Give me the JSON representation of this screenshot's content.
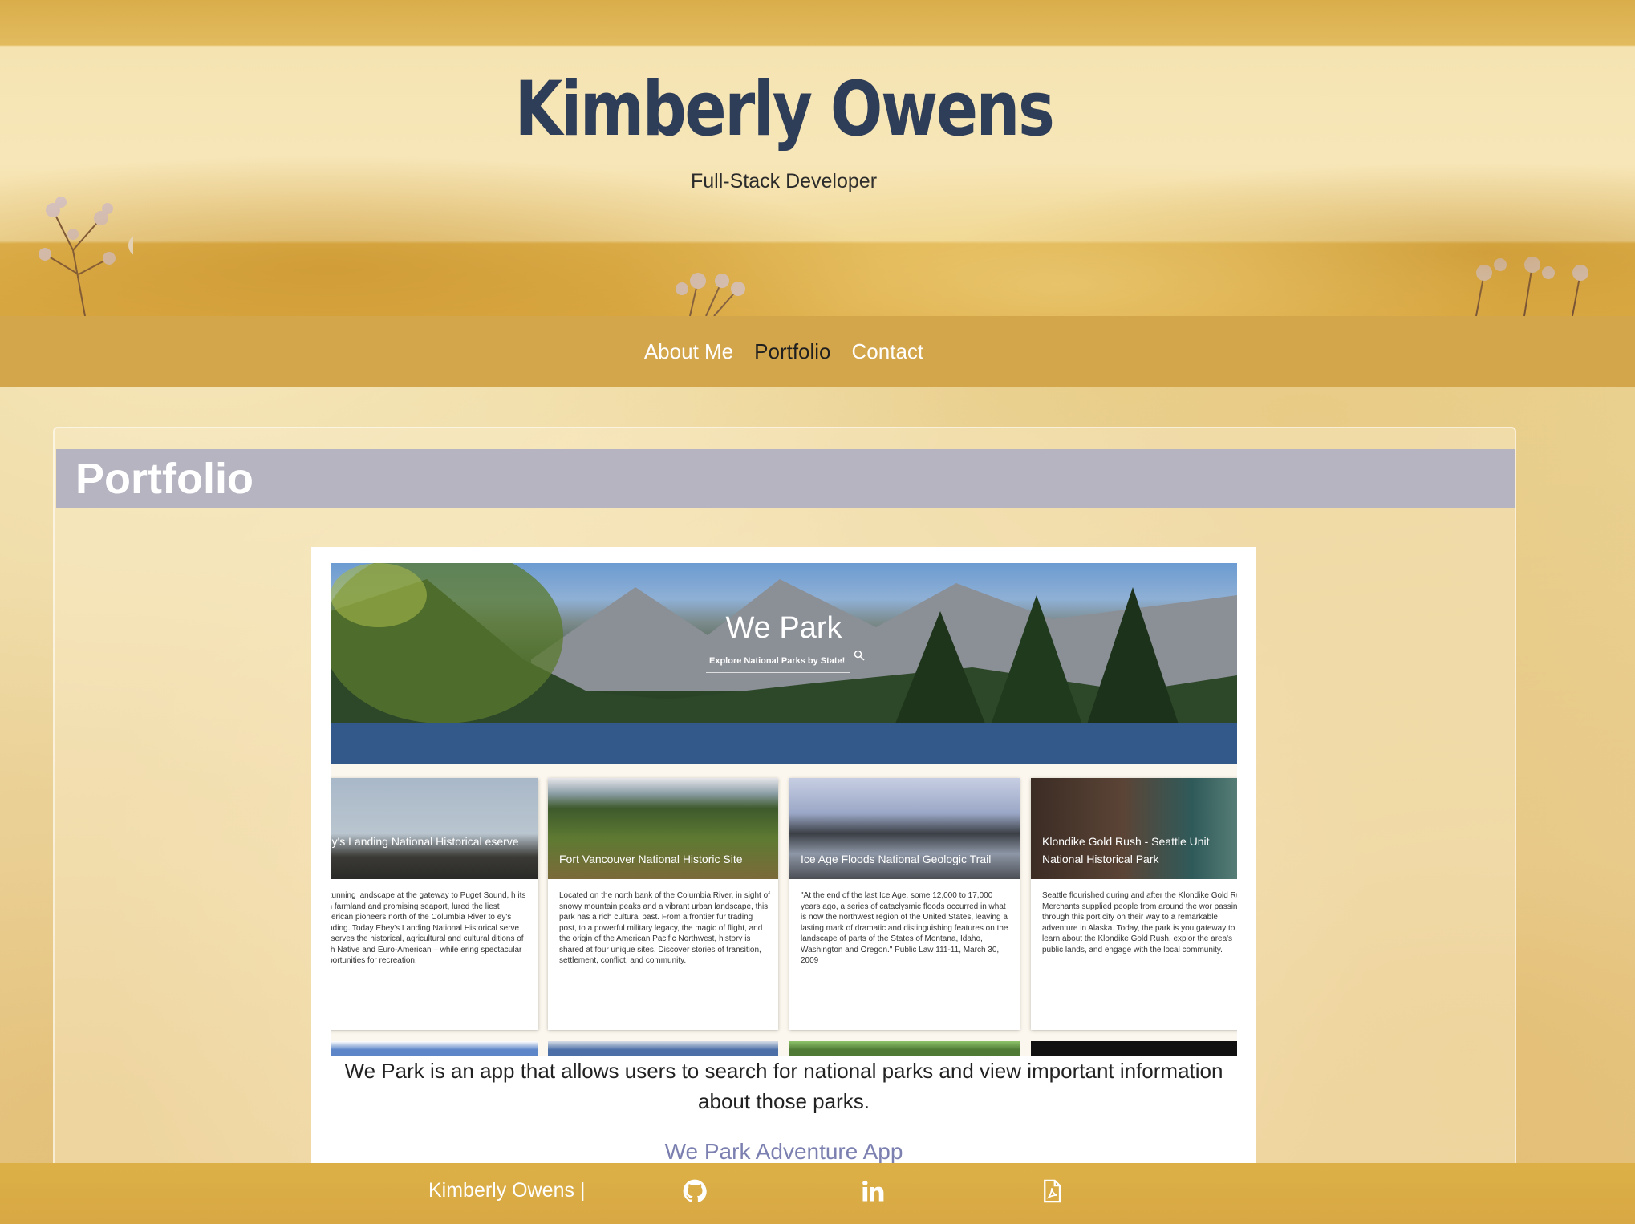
{
  "header": {
    "name": "Kimberly Owens",
    "subtitle": "Full-Stack Developer"
  },
  "nav": {
    "items": [
      {
        "label": "About Me",
        "active": false
      },
      {
        "label": "Portfolio",
        "active": true
      },
      {
        "label": "Contact",
        "active": false
      }
    ]
  },
  "portfolio": {
    "section_title": "Portfolio",
    "project": {
      "screenshot": {
        "hero_title": "We Park",
        "hero_subtitle": "Explore National Parks by State!",
        "parks": [
          {
            "name": "bey's Landing National Historical eserve",
            "description": "s stunning landscape at the gateway to Puget Sound, h its rich farmland and promising seaport, lured the liest American pioneers north of the Columbia River to ey's Landing. Today Ebey's Landing National Historical serve preserves the historical, agricultural and cultural ditions of both Native and Euro-American – while ering spectacular opportunities for recreation."
          },
          {
            "name": "Fort Vancouver National Historic Site",
            "description": "Located on the north bank of the Columbia River, in sight of snowy mountain peaks and a vibrant urban landscape, this park has a rich cultural past. From a frontier fur trading post, to a powerful military legacy, the magic of flight, and the origin of the American Pacific Northwest, history is shared at four unique sites. Discover stories of transition, settlement, conflict, and community."
          },
          {
            "name": "Ice Age Floods National Geologic Trail",
            "description": "\"At the end of the last Ice Age, some 12,000 to 17,000 years ago, a series of cataclysmic floods occurred in what is now the northwest region of the United States, leaving a lasting mark of dramatic and distinguishing features on the landscape of parts of the States of Montana, Idaho, Washington and Oregon.\" Public Law 111-11, March 30, 2009"
          },
          {
            "name": "Klondike Gold Rush - Seattle Unit National Historical Park",
            "description": "Seattle flourished during and after the Klondike Gold Rush. Merchants supplied people from around the wor passing through this port city on their way to a remarkable adventure in Alaska. Today, the park is you gateway to learn about the Klondike Gold Rush, explor the area's public lands, and engage with the local community."
          }
        ]
      },
      "description": "We Park is an app that allows users to search for national parks and view important information about those parks.",
      "link_label": "We Park Adventure App"
    }
  },
  "footer": {
    "name": "Kimberly Owens |",
    "icons": [
      "github-icon",
      "linkedin-icon",
      "pdf-resume-icon"
    ]
  },
  "colors": {
    "title": "#2f3e58",
    "navbar": "#d4a64c",
    "section_header": "#b7b4c1",
    "link": "#7b80b0"
  }
}
